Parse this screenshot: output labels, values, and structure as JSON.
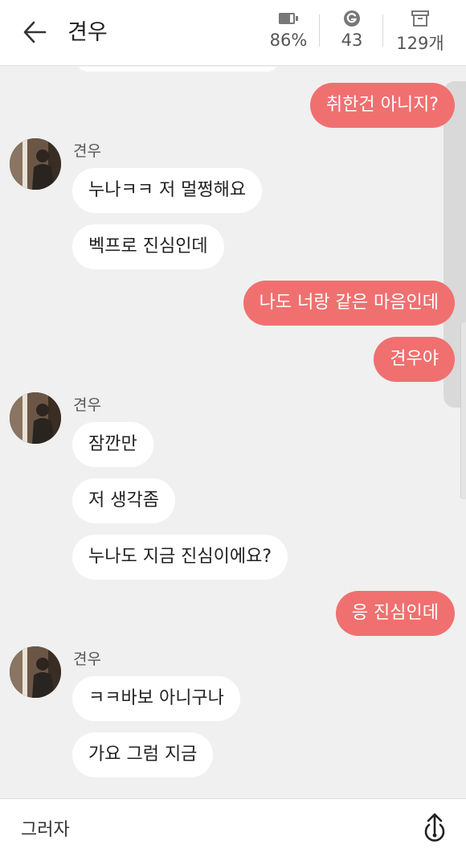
{
  "header": {
    "title": "견우",
    "stats": [
      {
        "icon": "battery-icon",
        "value": "86%"
      },
      {
        "icon": "g-coin-icon",
        "value": "43"
      },
      {
        "icon": "box-icon",
        "value": "129개"
      }
    ]
  },
  "chat": {
    "sender_name": "견우",
    "messages": [
      {
        "from": "me",
        "text": "취한건 아니지?"
      },
      {
        "from": "other",
        "text": "누나ㅋㅋ 저 멀쩡해요"
      },
      {
        "from": "other",
        "text": "벡프로 진심인데"
      },
      {
        "from": "me",
        "text": "나도 너랑 같은 마음인데"
      },
      {
        "from": "me",
        "text": "견우야"
      },
      {
        "from": "other",
        "text": "잠깐만"
      },
      {
        "from": "other",
        "text": "저 생각좀"
      },
      {
        "from": "other",
        "text": "누나도 지금 진심이에요?"
      },
      {
        "from": "me",
        "text": "응 진심인데"
      },
      {
        "from": "other",
        "text": "ㅋㅋ바보 아니구나"
      },
      {
        "from": "other",
        "text": "가요 그럼 지금"
      }
    ]
  },
  "input": {
    "value": "그러자"
  },
  "colors": {
    "accent": "#f07070",
    "chat_background": "#f0f0f0",
    "incoming_bubble": "#ffffff"
  }
}
